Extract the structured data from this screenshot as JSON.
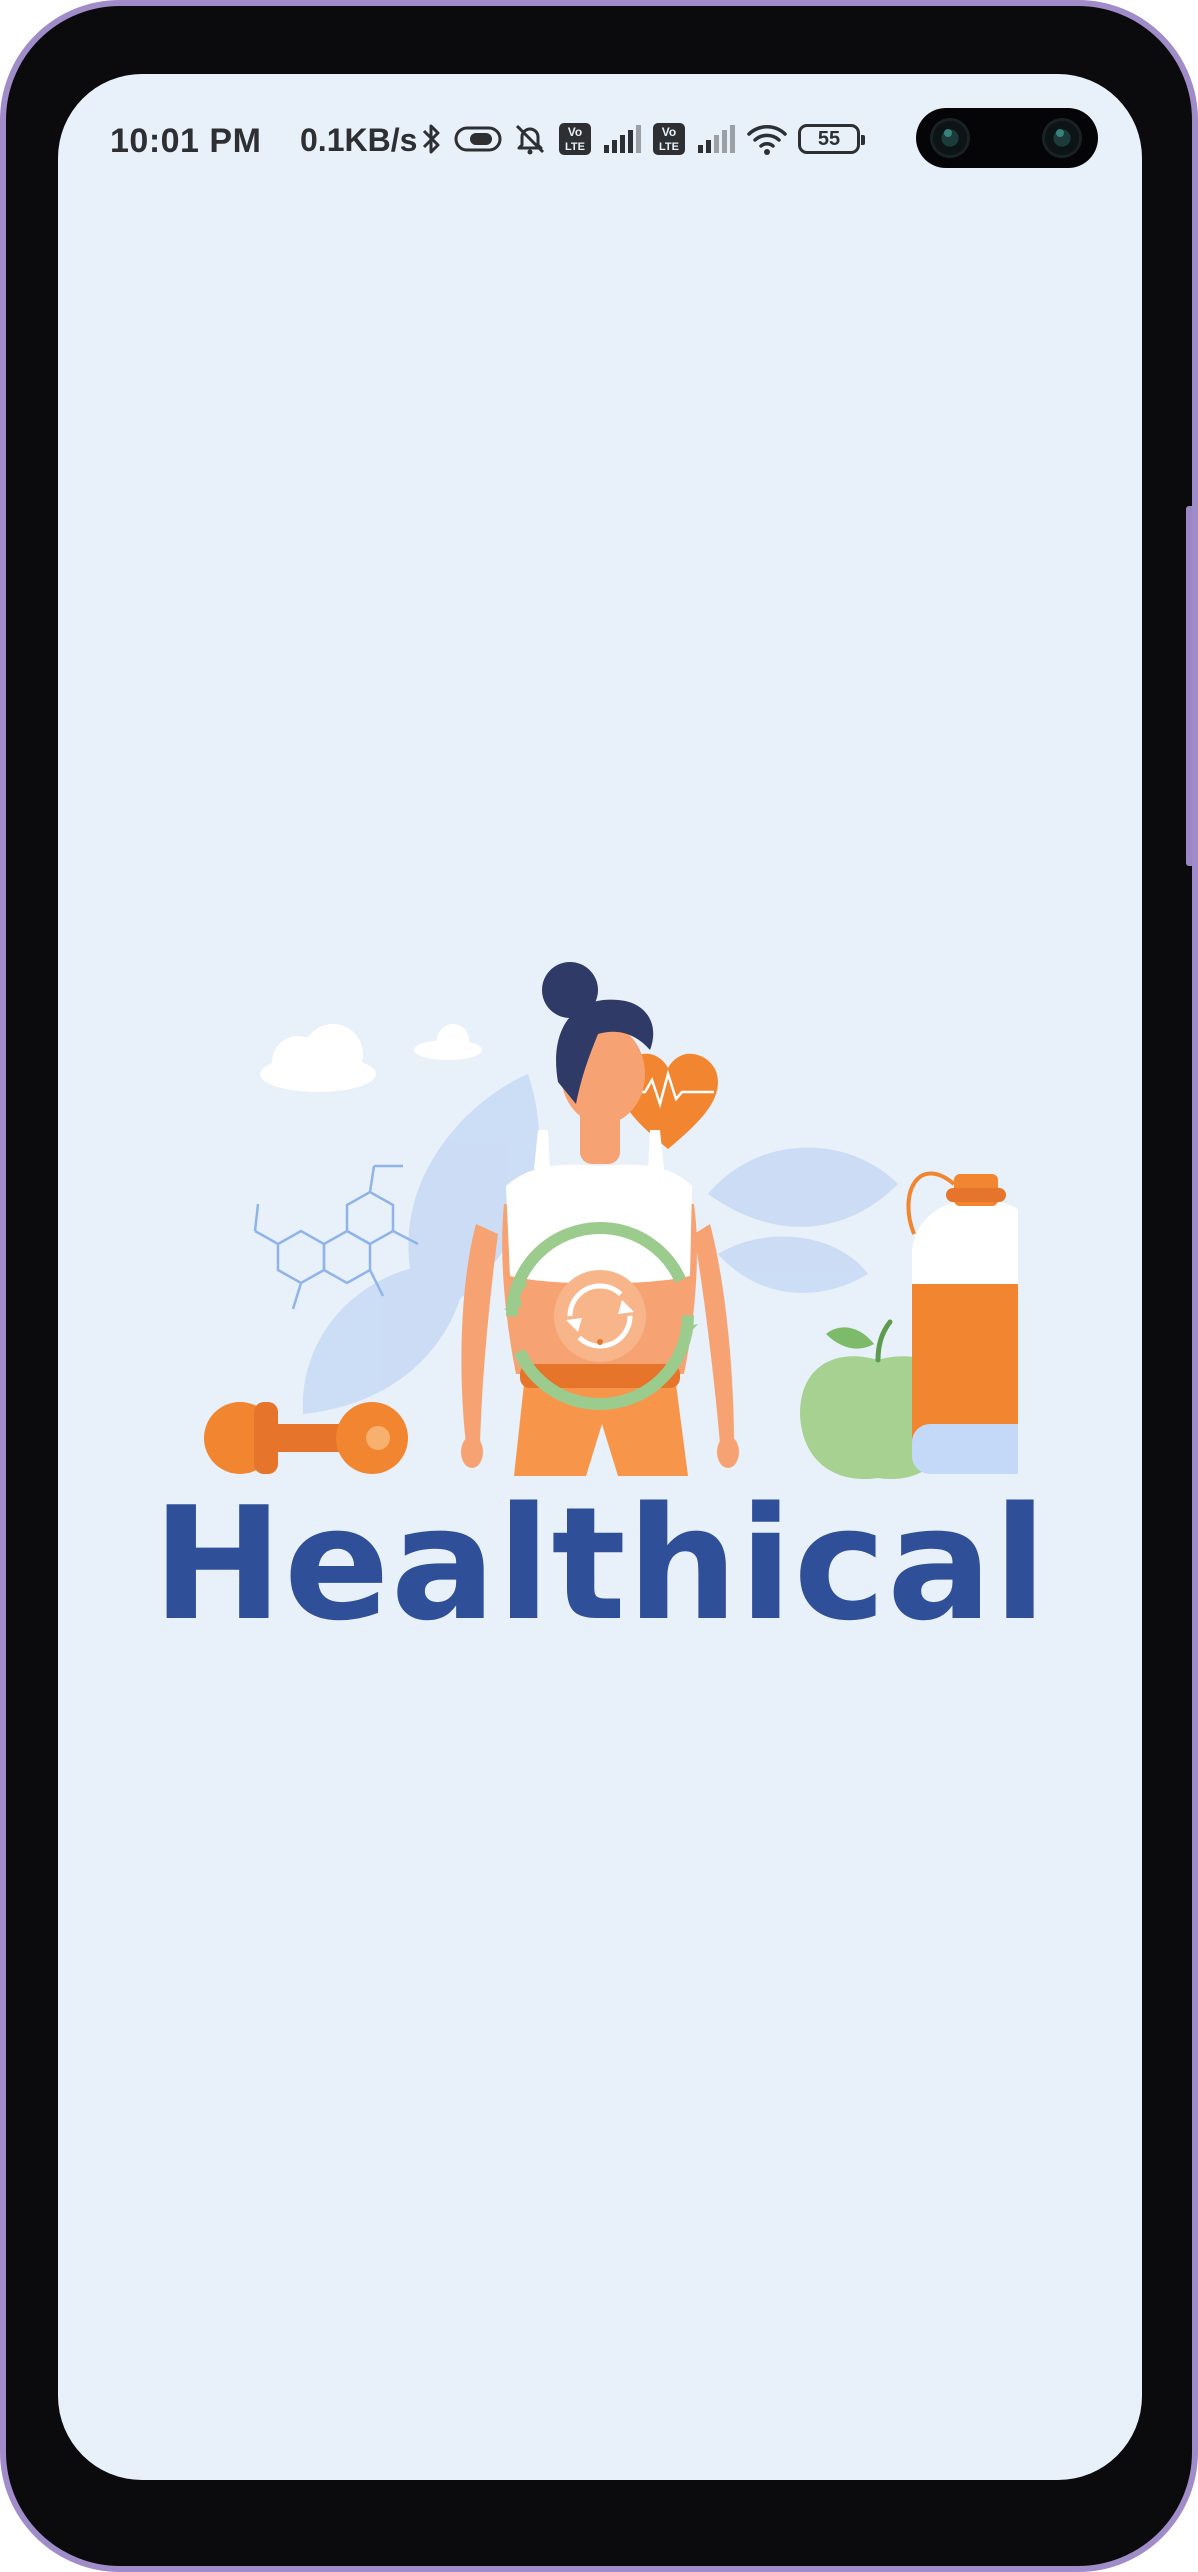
{
  "status_bar": {
    "time": "10:01 PM",
    "network_speed": "0.1KB/s",
    "icons": [
      "bluetooth-icon",
      "toggle-icon",
      "mute-icon",
      "volte-icon",
      "signal-icon",
      "volte-icon",
      "signal-icon",
      "wifi-icon"
    ],
    "battery_level": "55",
    "volte_label": "Vo LTE"
  },
  "splash": {
    "app_name": "Healthical",
    "illustration": "fitness-woman-illustration",
    "colors": {
      "brand": "#2f4f98",
      "background": "#e8f0f9",
      "accent_orange": "#f28530",
      "accent_green": "#9ccb8e",
      "hair": "#2f3a66"
    }
  }
}
